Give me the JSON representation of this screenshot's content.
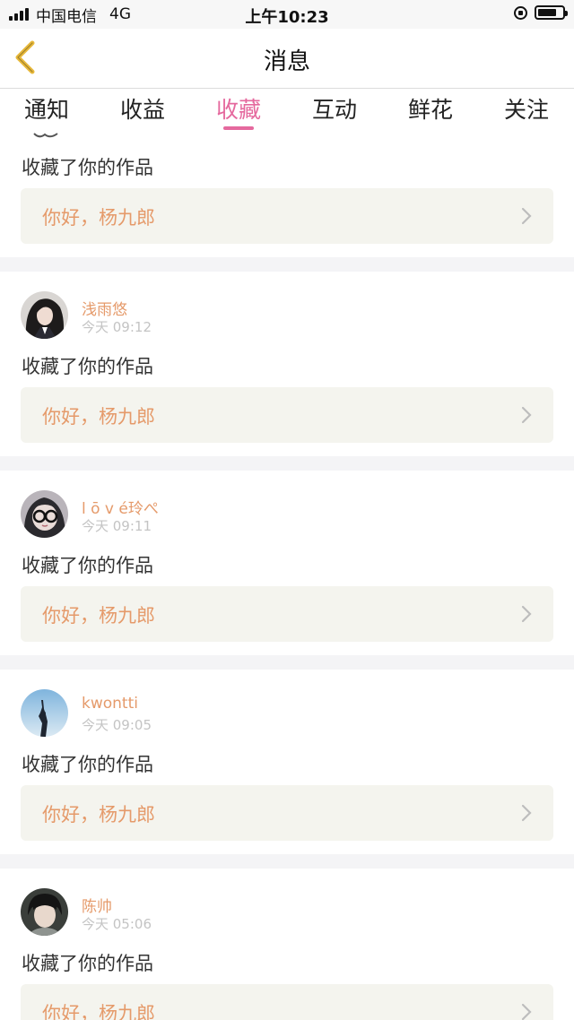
{
  "status_bar": {
    "carrier": "中国电信",
    "network": "4G",
    "time": "上午10:23",
    "battery_level": 0.75
  },
  "nav": {
    "title": "消息",
    "back_icon": "chevron-left-icon",
    "accent_color": "#e5699e"
  },
  "tabs": [
    {
      "label": "通知"
    },
    {
      "label": "收益"
    },
    {
      "label": "收藏",
      "active": true
    },
    {
      "label": "互动"
    },
    {
      "label": "鲜花"
    },
    {
      "label": "关注"
    }
  ],
  "top_card": {
    "action": "收藏了你的作品",
    "work_title": "你好，杨九郎"
  },
  "items": [
    {
      "name": "浅雨悠",
      "time": "今天 09:12",
      "action": "收藏了你的作品",
      "work_title": "你好，杨九郎",
      "avatar": "avatar-girl-dark-hair"
    },
    {
      "name": "l ō v é玲ぺ",
      "time": "今天 09:11",
      "action": "收藏了你的作品",
      "work_title": "你好，杨九郎",
      "avatar": "avatar-glasses"
    },
    {
      "name": "kwontti",
      "time": "今天 09:05",
      "action": "收藏了你的作品",
      "work_title": "你好，杨九郎",
      "avatar": "avatar-sky-silhouette"
    },
    {
      "name": "陈帅",
      "time": "今天 05:06",
      "action": "收藏了你的作品",
      "work_title": "你好，杨九郎",
      "avatar": "avatar-boy"
    }
  ]
}
